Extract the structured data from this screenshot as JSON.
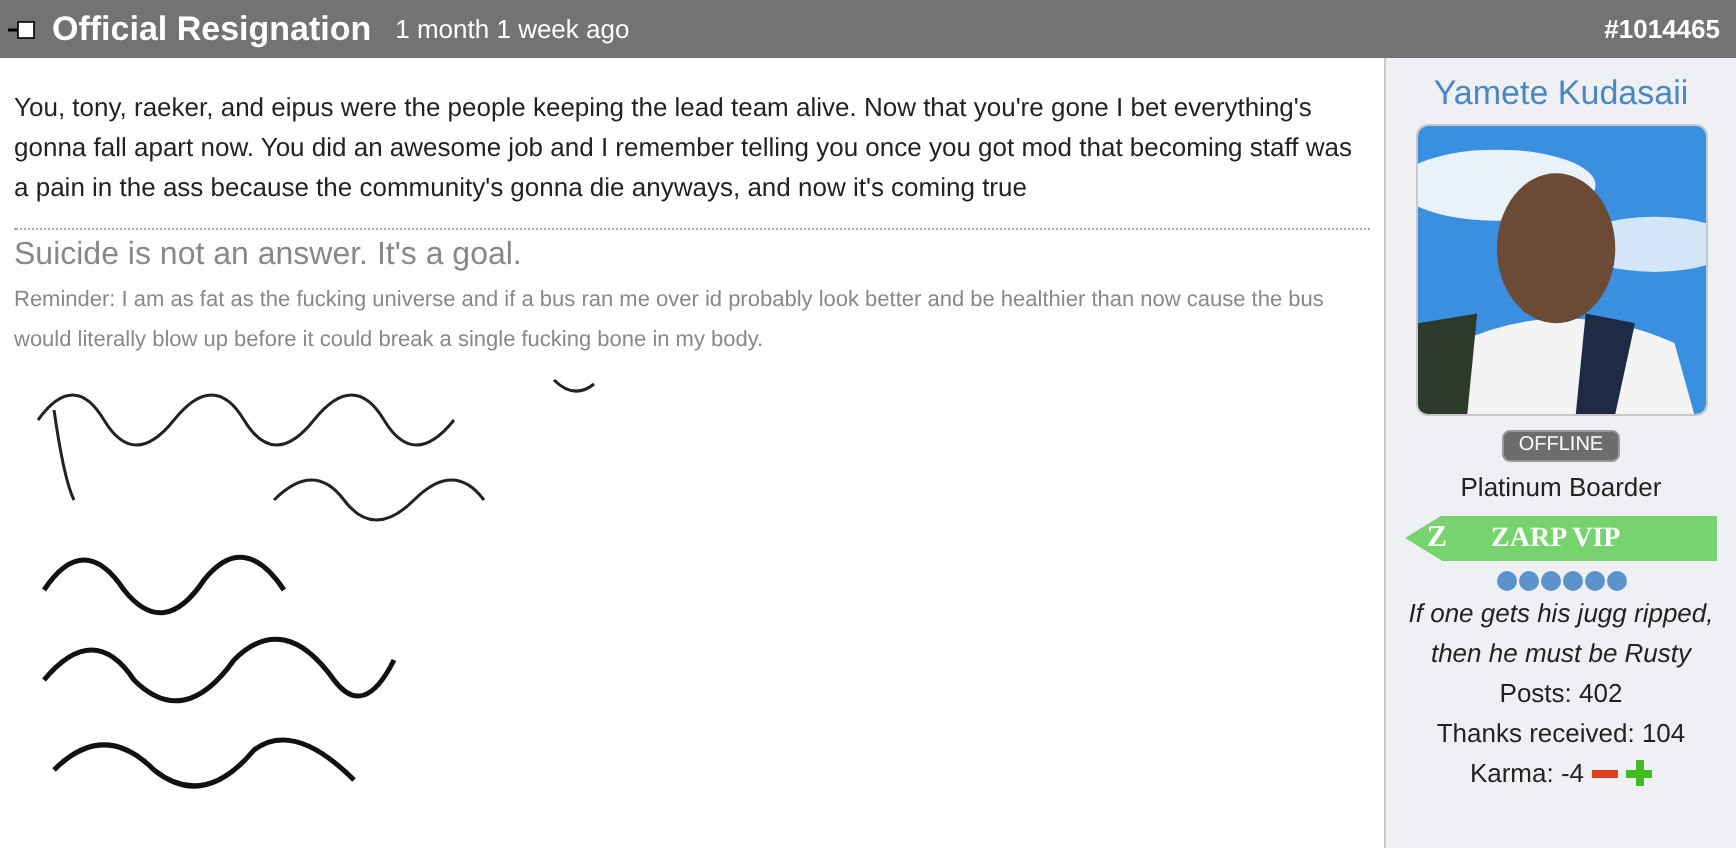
{
  "post": {
    "title": "Official Resignation",
    "age": "1 month 1 week ago",
    "number": "#1014465",
    "body": "You, tony, raeker, and eipus were the people keeping the lead team alive. Now that you're gone I bet everything's gonna fall apart now. You did an awesome job and I remember telling you once you got mod that becoming staff was a pain in the ass because the community's gonna die anyways, and now it's coming true",
    "signature": {
      "headline": "Suicide is not an answer. It's a goal.",
      "text": "Reminder: I am as fat as the fucking universe and if a bus ran me over id probably look better and be healthier than now cause the bus would literally blow up before it could break a single fucking bone in my body."
    }
  },
  "author": {
    "name": "Yamete Kudasaii",
    "status": "OFFLINE",
    "online": false,
    "rank": "Platinum Boarder",
    "badge_letter": "Z",
    "badge": "ZARP VIP",
    "motto": "If one gets his jugg ripped, then he must be Rusty",
    "posts": "Posts: 402",
    "thanks": "Thanks received: 104",
    "karma": "Karma: -4"
  }
}
